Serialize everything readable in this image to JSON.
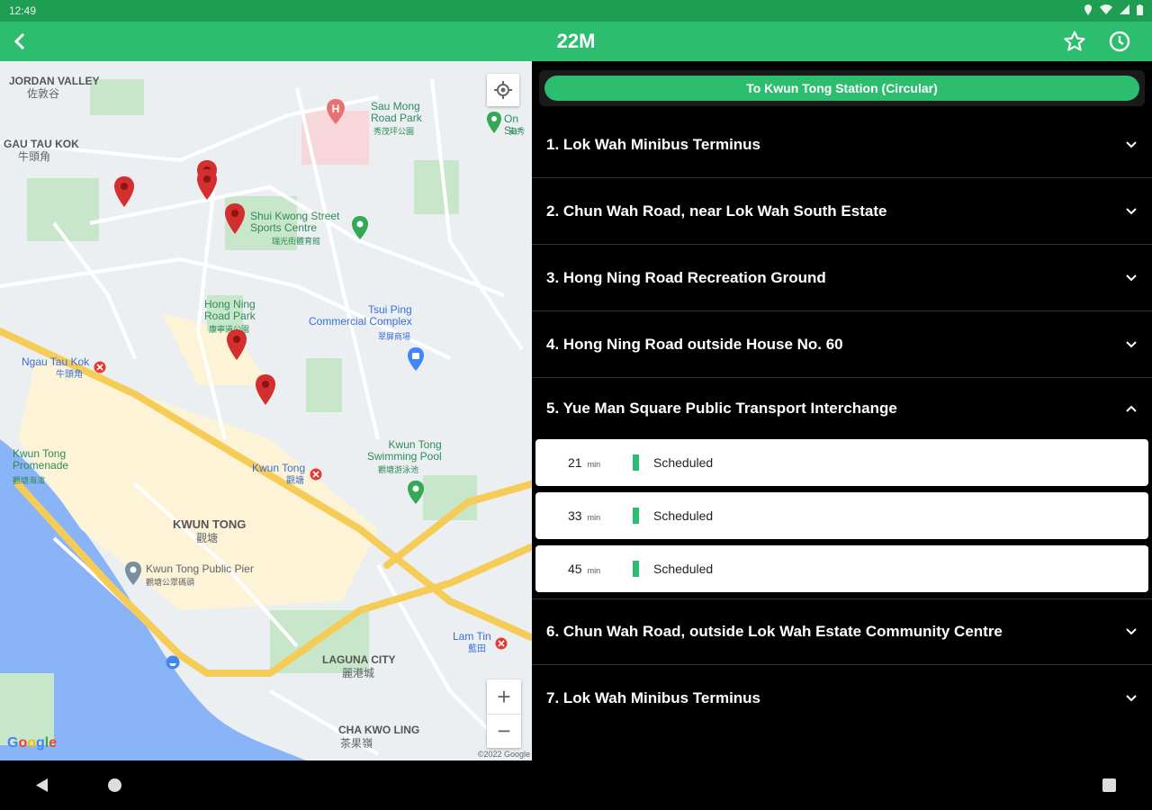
{
  "status_bar": {
    "time": "12:49"
  },
  "app_bar": {
    "title": "22M",
    "back_icon": "arrow-left-icon",
    "favorite_icon": "star-outline-icon",
    "schedule_icon": "clock-icon"
  },
  "map": {
    "labels": {
      "jordan_valley": "JORDAN VALLEY",
      "jordan_valley_zh": "佐敦谷",
      "ngau_tau_kok": "GAU TAU KOK",
      "ngau_tau_kok_zh": "牛頭角",
      "sau_ming_park": "Sau Mong\nRoad Park",
      "sau_ming_park_zh": "秀茂坪公園",
      "on_sau": "On Sa",
      "on_sau_zh": "安秀",
      "shui_kwong": "Shui Kwong Street\nSports Centre",
      "shui_kwong_zh": "瑞光街體育館",
      "hong_ning_park": "Hong Ning\nRoad Park",
      "hong_ning_park_zh": "康寧道公園",
      "tsui_ping": "Tsui Ping\nCommercial Complex",
      "tsui_ping_zh": "翠屏商場",
      "ngau_tau_kok_station": "Ngau Tau Kok",
      "ngau_tau_kok_station_zh": "牛頭角",
      "kwun_tong_pool": "Kwun Tong\nSwimming Pool",
      "kwun_tong_pool_zh": "觀塘游泳池",
      "kwun_tong_station": "Kwun Tong",
      "kwun_tong_station_zh": "觀塘",
      "promenade": "Kwun Tong\nPromenade",
      "promenade_zh": "觀塘海濱",
      "kwun_tong_district": "KWUN TONG",
      "kwun_tong_district_zh": "觀塘",
      "public_pier": "Kwun Tong Public Pier",
      "public_pier_zh": "觀塘公眾碼頭",
      "laguna_city": "LAGUNA CITY",
      "laguna_city_zh": "麗港城",
      "lam_tin": "Lam Tin",
      "lam_tin_zh": "藍田",
      "cha_kwo_ling": "CHA KWO LING",
      "cha_kwo_ling_zh": "茶果嶺",
      "google": "Google",
      "copyright": "©2022 Google"
    },
    "zoom_in": "+",
    "zoom_out": "−",
    "locate_icon": "my-location-icon"
  },
  "direction": {
    "label": "To Kwun Tong  Station (Circular)"
  },
  "stops": [
    {
      "label": "1. Lok Wah Minibus Terminus"
    },
    {
      "label": "2. Chun Wah Road, near Lok Wah South Estate"
    },
    {
      "label": "3. Hong Ning Road Recreation Ground"
    },
    {
      "label": "4. Hong Ning Road outside House No. 60"
    },
    {
      "label": "5. Yue Man Square Public Transport Interchange"
    },
    {
      "label": "6. Chun Wah Road, outside Lok Wah Estate Community Centre"
    },
    {
      "label": "7. Lok Wah Minibus Terminus"
    }
  ],
  "etas": [
    {
      "time": "21",
      "unit": "min",
      "status": "Scheduled"
    },
    {
      "time": "33",
      "unit": "min",
      "status": "Scheduled"
    },
    {
      "time": "45",
      "unit": "min",
      "status": "Scheduled"
    }
  ],
  "colors": {
    "accent": "#2dbd6e",
    "status_bar": "#1e9e52",
    "pin": "#d32f2f"
  }
}
